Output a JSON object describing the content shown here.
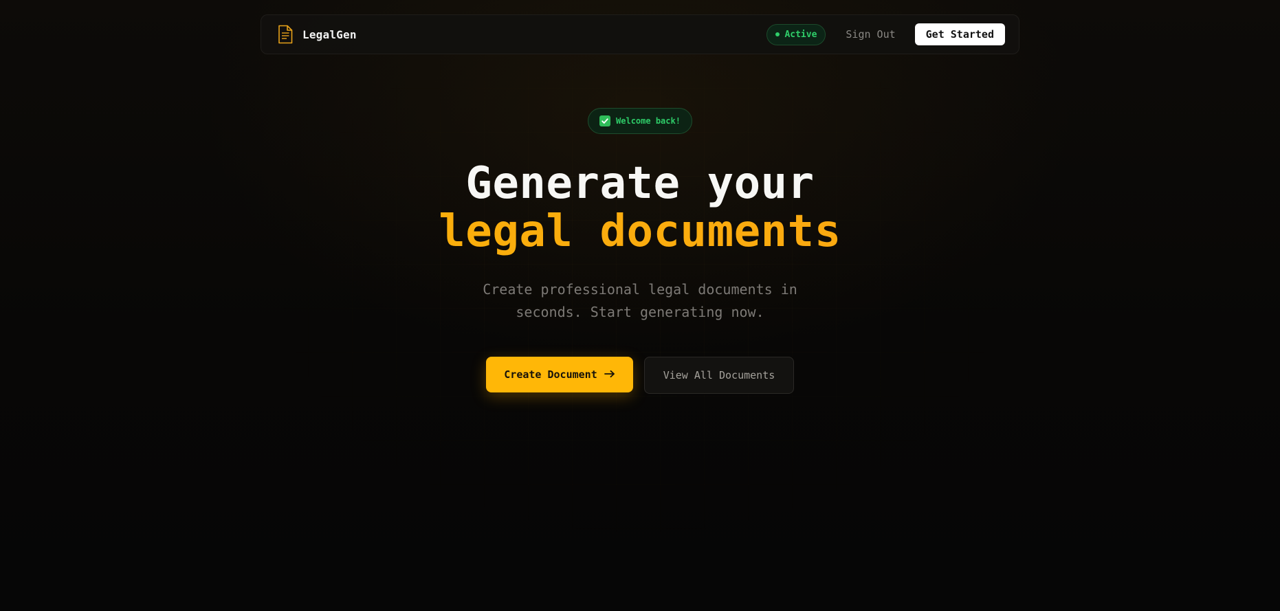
{
  "navbar": {
    "brand_name": "LegalGen",
    "brand_icon": "document-icon",
    "status_label": "Active",
    "sign_out_label": "Sign Out",
    "get_started_label": "Get Started"
  },
  "hero": {
    "welcome_label": "Welcome back!",
    "welcome_icon": "check-mark-icon",
    "headline_line1": "Generate your",
    "headline_line2": "legal documents",
    "subtext_line1": "Create professional legal documents in",
    "subtext_line2": "seconds. Start generating now.",
    "create_label": "Create Document",
    "create_icon": "arrow-right-icon",
    "view_all_label": "View All Documents"
  },
  "colors": {
    "accent": "#ffb707",
    "status_green": "#2fcf6a",
    "background": "#070605"
  }
}
